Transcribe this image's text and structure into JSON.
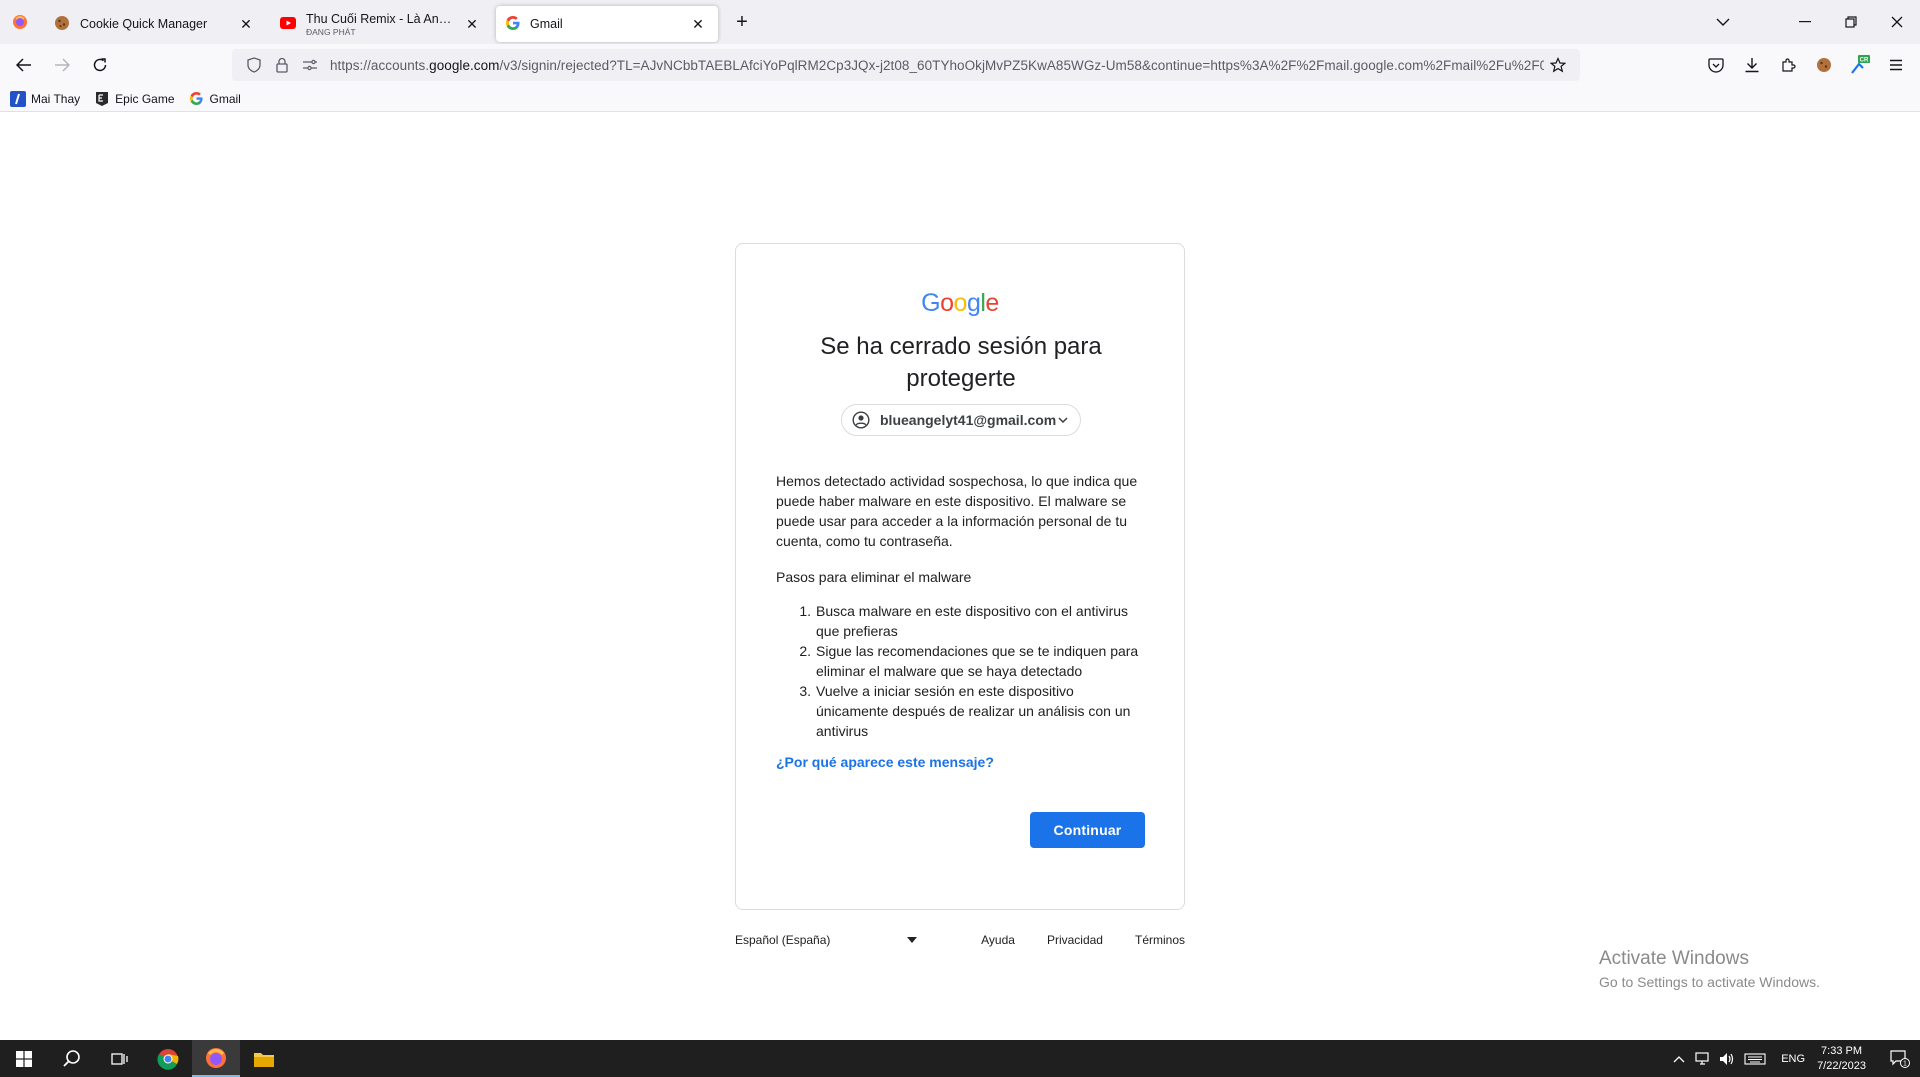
{
  "browser": {
    "tabs": [
      {
        "title": "Cookie Quick Manager",
        "subtitle": "",
        "active": false
      },
      {
        "title": "Thu Cuối Remix - Là Anh Remix",
        "subtitle": "ĐANG PHÁT",
        "active": false
      },
      {
        "title": "Gmail",
        "subtitle": "",
        "active": true
      }
    ],
    "url_prefix": "https://accounts.",
    "url_host": "google.com",
    "url_rest": "/v3/signin/rejected?TL=AJvNCbbTAEBLAfciYoPqlRM2Cp3JQx-j2t08_60TYhoOkjMvPZ5KwA85WGz-Um58&continue=https%3A%2F%2Fmail.google.com%2Fmail%2Fu%2F0%",
    "bookmarks": [
      {
        "label": "Mai Thay",
        "icon": "mai-thay-icon"
      },
      {
        "label": "Epic Game",
        "icon": "epic-games-icon"
      },
      {
        "label": "Gmail",
        "icon": "google-icon"
      }
    ]
  },
  "page": {
    "logo_letters": [
      "G",
      "o",
      "o",
      "g",
      "l",
      "e"
    ],
    "logo_colors": [
      "#4285F4",
      "#EA4335",
      "#FBBC05",
      "#4285F4",
      "#34A853",
      "#EA4335"
    ],
    "heading": "Se ha cerrado sesión para protegerte",
    "account_email": "blueangelyt41@gmail.com",
    "body": "Hemos detectado actividad sospechosa, lo que indica que puede haber malware en este dispositivo. El malware se puede usar para acceder a la información personal de tu cuenta, como tu contraseña.",
    "steps_title": "Pasos para eliminar el malware",
    "steps": [
      {
        "num": "1.",
        "text": "Busca malware en este dispositivo con el antivirus que prefieras"
      },
      {
        "num": "2.",
        "text": "Sigue las recomendaciones que se te indiquen para eliminar el malware que se haya detectado"
      },
      {
        "num": "3.",
        "text": "Vuelve a iniciar sesión en este dispositivo únicamente después de realizar un análisis con un antivirus"
      }
    ],
    "why_link": "¿Por qué aparece este mensaje?",
    "continue_label": "Continuar",
    "accent": "#1a73e8"
  },
  "footer": {
    "language": "Español (España)",
    "links": [
      "Ayuda",
      "Privacidad",
      "Términos"
    ]
  },
  "watermark": {
    "line1": "Activate Windows",
    "line2": "Go to Settings to activate Windows."
  },
  "taskbar": {
    "lang": "ENG",
    "time": "7:33 PM",
    "date": "7/22/2023",
    "notif_count": "1"
  }
}
